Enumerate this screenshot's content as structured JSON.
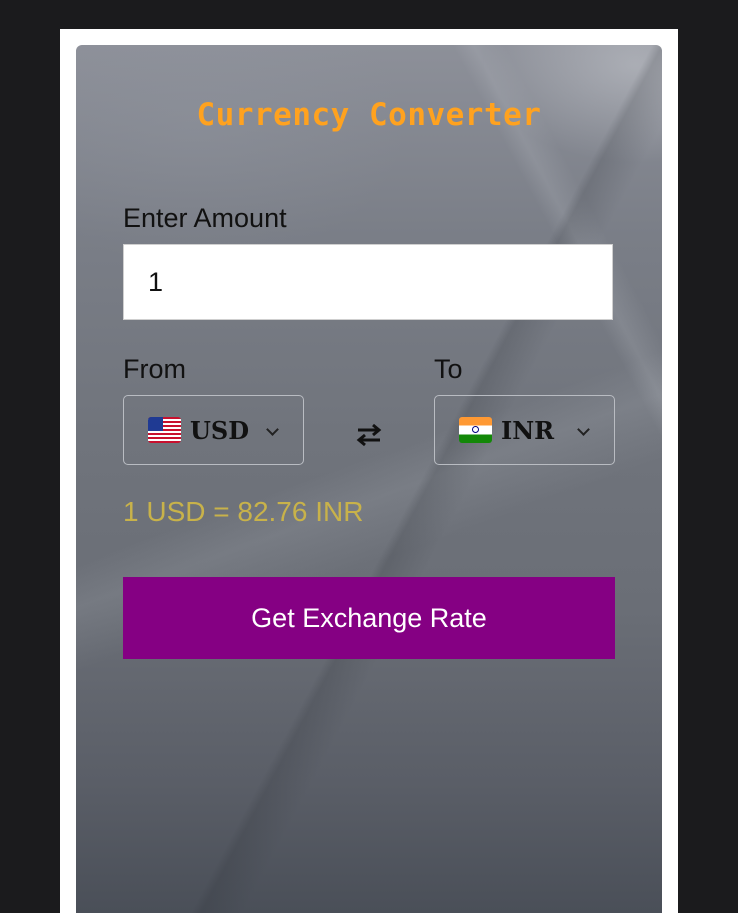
{
  "app": {
    "title": "Currency Converter"
  },
  "amount": {
    "label": "Enter Amount",
    "value": "1"
  },
  "from": {
    "label": "From",
    "currency": "USD",
    "flag_icon": "us-flag-icon"
  },
  "to": {
    "label": "To",
    "currency": "INR",
    "flag_icon": "india-flag-icon"
  },
  "swap": {
    "icon": "swap-arrows-icon"
  },
  "result": {
    "text": "1 USD = 82.76 INR"
  },
  "action": {
    "button_label": "Get Exchange Rate"
  },
  "colors": {
    "title": "#ffa21f",
    "result": "#c8b24a",
    "button": "#850083"
  }
}
